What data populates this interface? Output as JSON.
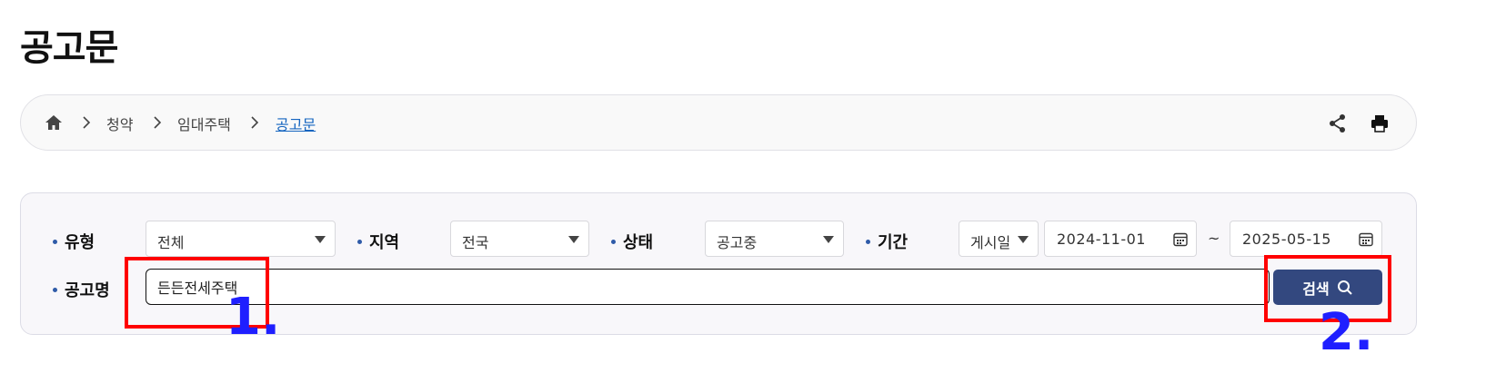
{
  "page": {
    "title": "공고문"
  },
  "breadcrumb": {
    "items": [
      "청약",
      "임대주택",
      "공고문"
    ]
  },
  "filters": {
    "type": {
      "label": "유형",
      "value": "전체"
    },
    "region": {
      "label": "지역",
      "value": "전국"
    },
    "status": {
      "label": "상태",
      "value": "공고중"
    },
    "period": {
      "label": "기간",
      "basis": "게시일",
      "start": "2024-11-01",
      "separator": "~",
      "end": "2025-05-15"
    },
    "name": {
      "label": "공고명",
      "value": "든든전세주택"
    },
    "search_label": "검색"
  },
  "annotations": {
    "first": "1.",
    "second": "2.",
    "color_box": "#ff0000",
    "color_number": "#1f1fff"
  },
  "icons": {
    "home": "home-icon",
    "chevron": "chevron-right-icon",
    "share": "share-icon",
    "print": "print-icon",
    "calendar": "calendar-icon",
    "search": "search-icon"
  },
  "colors": {
    "accent": "#33487f",
    "link": "#1565c0",
    "bullet": "#2f5ba8"
  }
}
